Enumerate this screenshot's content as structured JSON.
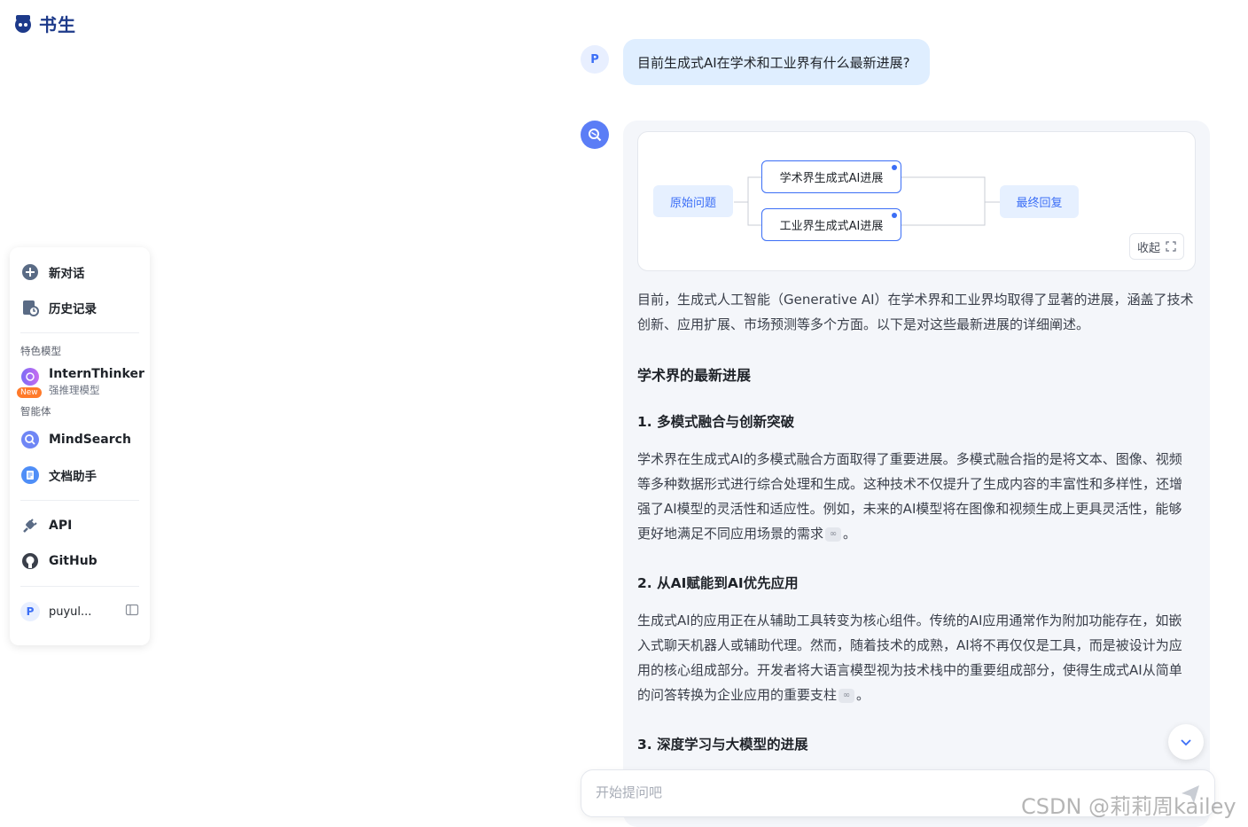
{
  "brand": {
    "logo_text": "书生"
  },
  "sidebar": {
    "new_chat": "新对话",
    "history": "历史记录",
    "featured_label": "特色模型",
    "featured_model": {
      "name": "InternThinker",
      "subtitle": "强推理模型",
      "badge": "New"
    },
    "agents_label": "智能体",
    "agents": [
      {
        "label": "MindSearch"
      },
      {
        "label": "文档助手"
      }
    ],
    "links": [
      {
        "label": "API"
      },
      {
        "label": "GitHub"
      }
    ],
    "user": {
      "avatar": "P",
      "name": "puyul..."
    }
  },
  "chat": {
    "user_avatar": "P",
    "question": "目前生成式AI在学术和工业界有什么最新进展?",
    "graph": {
      "root": "原始问题",
      "branches": [
        "学术界生成式AI进展",
        "工业界生成式AI进展"
      ],
      "final": "最终回复",
      "collapse_label": "收起"
    },
    "intro": "目前，生成式人工智能（Generative AI）在学术界和工业界均取得了显著的进展，涵盖了技术创新、应用扩展、市场预测等多个方面。以下是对这些最新进展的详细阐述。",
    "section_title": "学术界的最新进展",
    "items": [
      {
        "title": "1. 多模式融合与创新突破",
        "body": "学术界在生成式AI的多模式融合方面取得了重要进展。多模式融合指的是将文本、图像、视频等多种数据形式进行综合处理和生成。这种技术不仅提升了生成内容的丰富性和多样性，还增强了AI模型的灵活性和适应性。例如，未来的AI模型将在图像和视频生成上更具灵活性，能够更好地满足不同应用场景的需求",
        "tail": "。"
      },
      {
        "title": "2. 从AI赋能到AI优先应用",
        "body": "生成式AI的应用正在从辅助工具转变为核心组件。传统的AI应用通常作为附加功能存在，如嵌入式聊天机器人或辅助代理。然而，随着技术的成熟，AI将不再仅仅是工具，而是被设计为应用的核心组成部分。开发者将大语言模型视为技术栈中的重要组成部分，使得生成式AI从简单的问答转换为企业应用的重要支柱",
        "tail": "。"
      },
      {
        "title": "3. 深度学习与大模型的进展"
      }
    ]
  },
  "input": {
    "placeholder": "开始提问吧"
  },
  "watermark": "CSDN @莉莉周kailey",
  "colors": {
    "accent": "#3b6ef6",
    "bubble": "#dfeeff",
    "answer_bg": "#f4f6fa"
  }
}
